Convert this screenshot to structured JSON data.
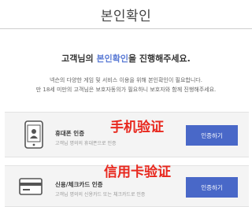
{
  "page": {
    "title": "본인확인"
  },
  "headline": {
    "prefix": "고객님의 ",
    "accent": "본인확인",
    "suffix": "을 진행해주세요.",
    "accent_color": "#5b7bd5"
  },
  "description": {
    "line1": "넥슨의 다양한 게임 및 서비스 이용을 위해 본인확인이 필요합니다.",
    "line2": "만 18세 미만의 고객님은 보호자동의가 필요하니 보호자와 함께 진행해주세요."
  },
  "methods": [
    {
      "icon": "smartphone-icon",
      "title": "휴대폰 인증",
      "subtitle": "고객님 명의의 휴대폰으로 인증",
      "button": "인증하기",
      "overlay": "手机验证"
    },
    {
      "icon": "credit-card-icon",
      "title": "신용/체크카드 인증",
      "subtitle": "고객님 명의의 신용카드 또는 체크카드로 인증",
      "button": "인증하기",
      "overlay": "信用卡验证"
    }
  ],
  "colors": {
    "button": "#4968c8",
    "overlay_text": "#e8281e",
    "card_background": "#f4f4f4"
  }
}
